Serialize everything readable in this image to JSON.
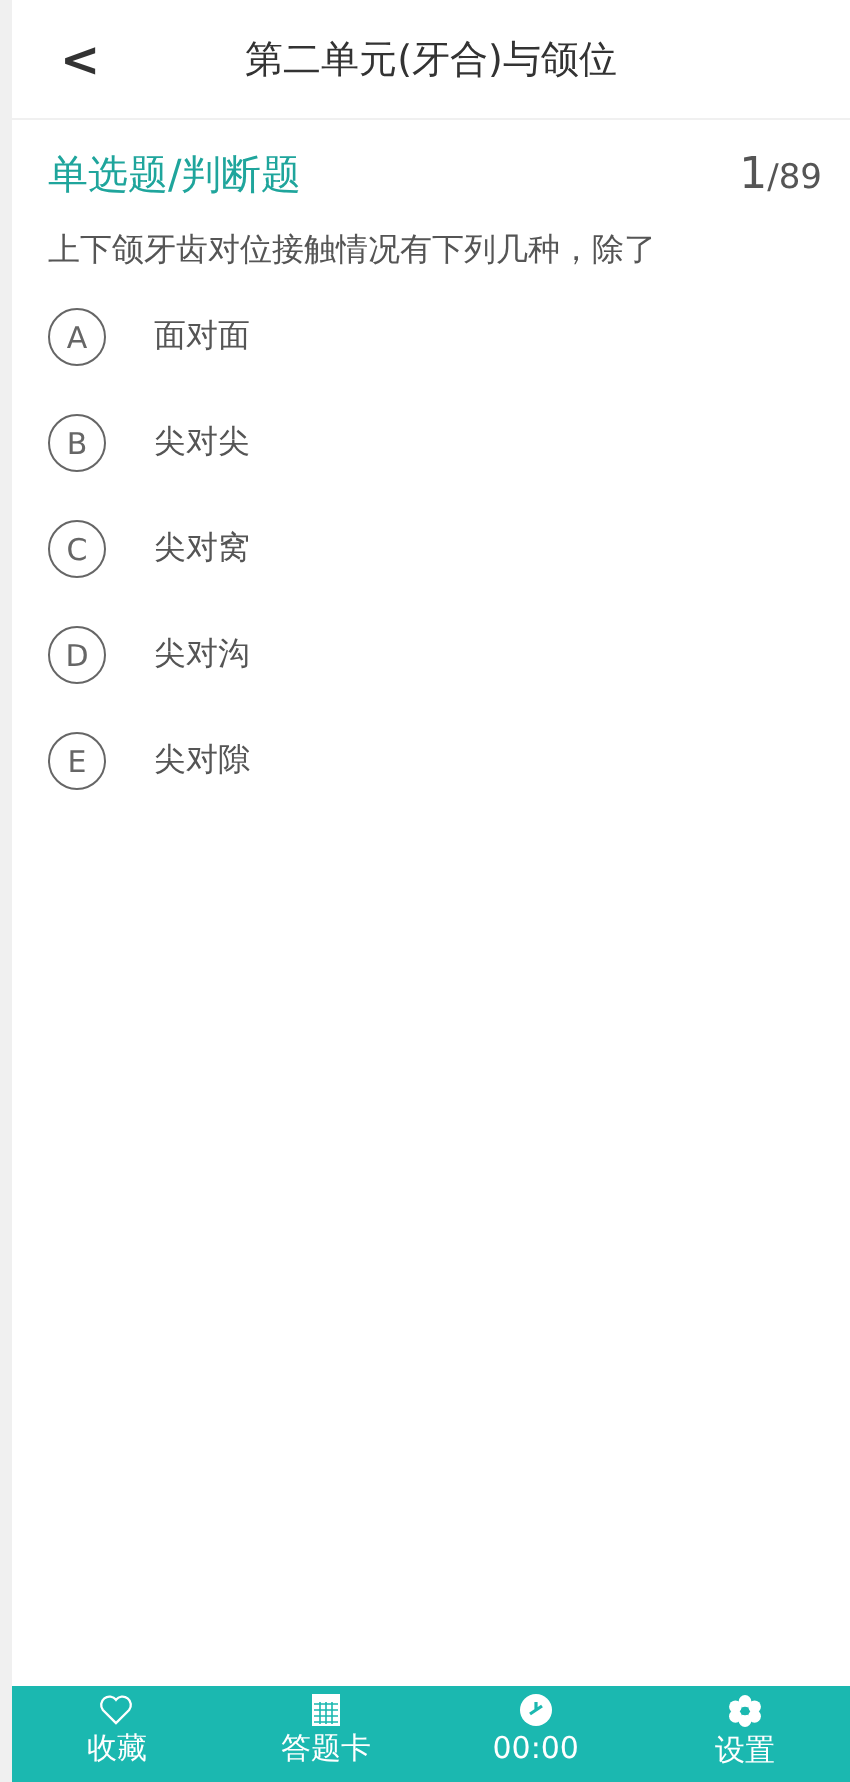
{
  "header": {
    "back": "<",
    "title": "第二单元(牙合)与颌位"
  },
  "question": {
    "type": "单选题/判断题",
    "current": "1",
    "total": "/89",
    "text": "上下颌牙齿对位接触情况有下列几种，除了"
  },
  "options": [
    {
      "letter": "A",
      "text": "面对面",
      "selected": false
    },
    {
      "letter": "B",
      "text": "尖对尖",
      "selected": false
    },
    {
      "letter": "C",
      "text": "尖对窝",
      "selected": false
    },
    {
      "letter": "D",
      "text": "尖对沟",
      "selected": false
    },
    {
      "letter": "E",
      "text": "尖对隙",
      "selected": false
    }
  ],
  "bottom_bar": [
    {
      "kind": "favorite",
      "label": "收藏"
    },
    {
      "kind": "card",
      "label": "答题卡"
    },
    {
      "kind": "timer",
      "label": "00:00"
    },
    {
      "kind": "settings",
      "label": "设置"
    }
  ]
}
